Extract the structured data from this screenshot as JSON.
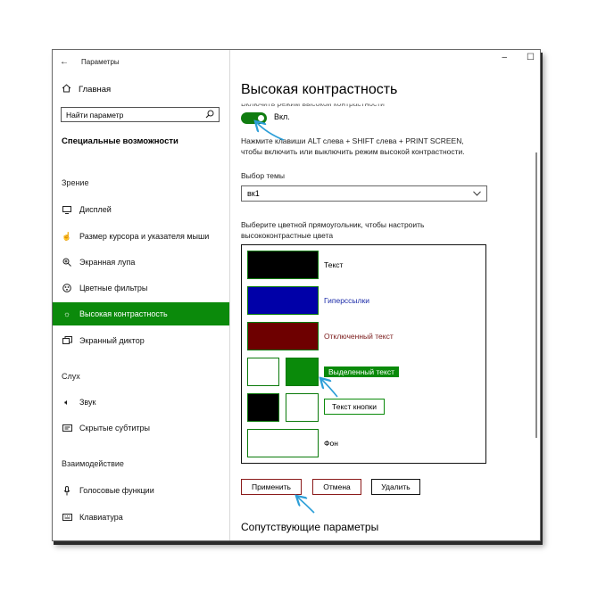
{
  "window": {
    "title": "Параметры",
    "controls": [
      "–",
      "☐"
    ]
  },
  "sidebar": {
    "home_label": "Главная",
    "search_placeholder": "Найти параметр",
    "section_title": "Специальные возможности",
    "groups": {
      "vision": "Зрение",
      "hearing": "Слух",
      "interaction": "Взаимодействие"
    },
    "items": [
      {
        "label": "Дисплей",
        "icon": "display-icon"
      },
      {
        "label": "Размер курсора и указателя мыши",
        "icon": "cursor-icon"
      },
      {
        "label": "Экранная лупа",
        "icon": "magnifier-icon"
      },
      {
        "label": "Цветные фильтры",
        "icon": "color-filter-icon"
      },
      {
        "label": "Высокая контрастность",
        "icon": "contrast-icon",
        "active": true
      },
      {
        "label": "Экранный диктор",
        "icon": "narrator-icon"
      },
      {
        "label": "Звук",
        "icon": "speaker-icon"
      },
      {
        "label": "Скрытые субтитры",
        "icon": "captions-icon"
      },
      {
        "label": "Голосовые функции",
        "icon": "microphone-icon"
      },
      {
        "label": "Клавиатура",
        "icon": "keyboard-icon"
      }
    ]
  },
  "main": {
    "title": "Высокая контрастность",
    "toggle_caption_clipped": "Включить режим высокой контрастности",
    "toggle_state": "Вкл.",
    "hint_line1": "Нажмите клавиши ALT слева + SHIFT слева + PRINT SCREEN,",
    "hint_line2": "чтобы включить или выключить режим высокой контрастности.",
    "theme_label": "Выбор темы",
    "theme_value": "вк1",
    "color_hint_line1": "Выберите цветной прямоугольник, чтобы настроить",
    "color_hint_line2": "высококонтрастные цвета",
    "swatches": {
      "text": "Текст",
      "hyperlinks": "Гиперссылки",
      "disabled_text": "Отключенный текст",
      "selected_text": "Выделенный текст",
      "button_text": "Текст кнопки",
      "background": "Фон"
    },
    "buttons": {
      "apply": "Применить",
      "cancel": "Отмена",
      "delete": "Удалить"
    },
    "related_title": "Сопутствующие параметры"
  },
  "colors": {
    "accent": "#107c10",
    "text_swatch": "#000000",
    "hyperlink_swatch": "#0000a8",
    "disabled_swatch": "#6e0000",
    "selected_swatch": "#0a8a0a",
    "button_red": "#8b1a1a",
    "annotation_arrow": "#2d9fd8"
  }
}
